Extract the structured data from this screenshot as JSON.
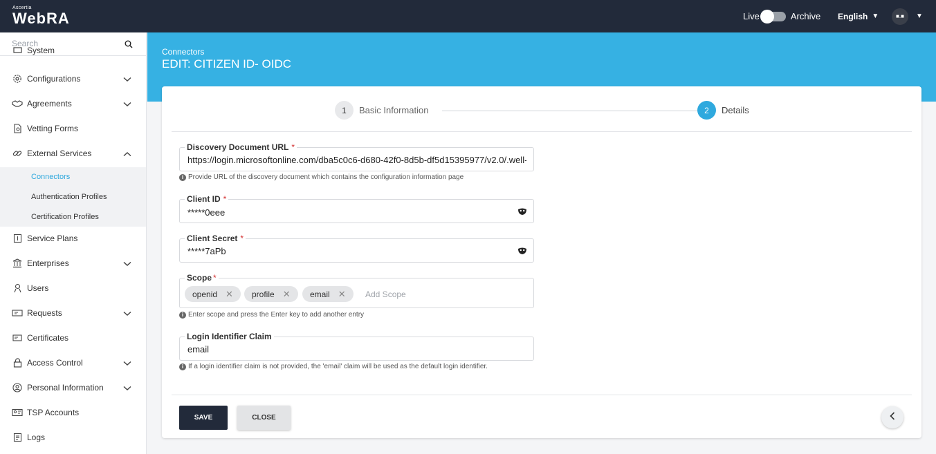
{
  "header": {
    "brand": "Ascertia",
    "app_name": "WebRA",
    "live_label": "Live",
    "archive_label": "Archive",
    "language": "English",
    "avatar_initials": "■.■"
  },
  "sidebar": {
    "search_placeholder": "Search",
    "partial_item": "System",
    "items": [
      {
        "label": "Configurations",
        "icon": "gear-icon",
        "expandable": true
      },
      {
        "label": "Agreements",
        "icon": "handshake-icon",
        "expandable": true
      },
      {
        "label": "Vetting Forms",
        "icon": "document-search-icon",
        "expandable": false
      },
      {
        "label": "External Services",
        "icon": "link-icon",
        "expandable": true,
        "expanded": true
      },
      {
        "label": "Service Plans",
        "icon": "plan-icon",
        "expandable": false
      },
      {
        "label": "Enterprises",
        "icon": "bank-icon",
        "expandable": true
      },
      {
        "label": "Users",
        "icon": "user-badge-icon",
        "expandable": false
      },
      {
        "label": "Requests",
        "icon": "requests-icon",
        "expandable": true
      },
      {
        "label": "Certificates",
        "icon": "certificate-icon",
        "expandable": false
      },
      {
        "label": "Access Control",
        "icon": "lock-icon",
        "expandable": true
      },
      {
        "label": "Personal Information",
        "icon": "user-circle-icon",
        "expandable": true
      },
      {
        "label": "TSP Accounts",
        "icon": "account-card-icon",
        "expandable": false
      },
      {
        "label": "Logs",
        "icon": "logs-icon",
        "expandable": false
      }
    ],
    "sub_items": [
      {
        "label": "Connectors",
        "active": true
      },
      {
        "label": "Authentication Profiles",
        "active": false
      },
      {
        "label": "Certification Profiles",
        "active": false
      }
    ]
  },
  "page": {
    "breadcrumb": "Connectors",
    "title": "EDIT: CITIZEN ID- OIDC"
  },
  "stepper": {
    "steps": [
      {
        "number": "1",
        "label": "Basic Information"
      },
      {
        "number": "2",
        "label": "Details"
      }
    ]
  },
  "form": {
    "discovery_url": {
      "label": "Discovery Document URL",
      "value": "https://login.microsoftonline.com/dba5c0c6-d680-42f0-8d5b-df5d15395977/v2.0/.well-",
      "hint": "Provide URL of the discovery document which contains the configuration information page"
    },
    "client_id": {
      "label": "Client ID",
      "value": "*****0eee"
    },
    "client_secret": {
      "label": "Client Secret",
      "value": "*****7aPb"
    },
    "scope": {
      "label": "Scope",
      "chips": [
        "openid",
        "profile",
        "email"
      ],
      "placeholder": "Add Scope",
      "hint": "Enter scope and press the Enter key to add another entry"
    },
    "login_claim": {
      "label": "Login Identifier Claim",
      "value": "email",
      "hint": "If a login identifier claim is not provided, the 'email' claim will be used as the default login identifier."
    },
    "required_mark": "*"
  },
  "actions": {
    "save": "SAVE",
    "close": "CLOSE"
  },
  "colors": {
    "topbar": "#222a3a",
    "accent": "#36b1e3",
    "active_link": "#2fa9de"
  }
}
